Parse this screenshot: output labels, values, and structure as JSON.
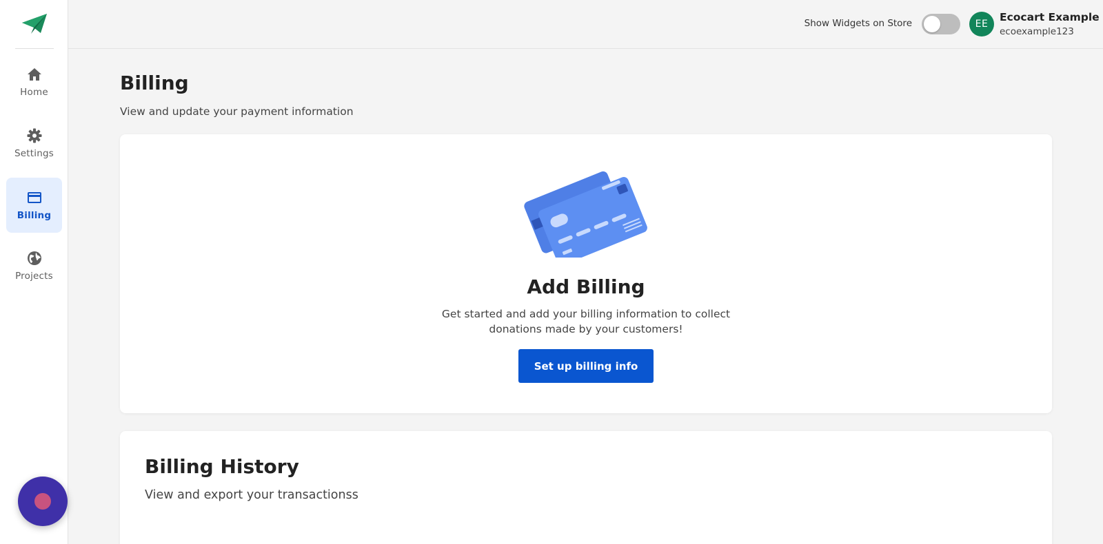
{
  "sidebar": {
    "logo_icon": "paper-plane-icon",
    "items": [
      {
        "label": "Home",
        "icon": "home-icon",
        "active": false
      },
      {
        "label": "Settings",
        "icon": "gear-icon",
        "active": false
      },
      {
        "label": "Billing",
        "icon": "credit-card-icon",
        "active": true
      },
      {
        "label": "Projects",
        "icon": "globe-icon",
        "active": false
      }
    ],
    "chat_icon": "chat-bubble-icon"
  },
  "topbar": {
    "toggle_label": "Show Widgets on Store",
    "toggle_on": false,
    "avatar_initials": "EE",
    "user_name": "Ecocart Example",
    "user_handle": "ecoexample123"
  },
  "page": {
    "title": "Billing",
    "subtitle": "View and update your payment information"
  },
  "add_billing": {
    "illustration": "credit-cards-illustration",
    "title": "Add Billing",
    "description": "Get started and add your billing information to collect donations made by your customers!",
    "button_label": "Set up billing info"
  },
  "billing_history": {
    "title": "Billing History",
    "subtitle": "View and export your transactionss"
  },
  "colors": {
    "brand_green": "#12855a",
    "primary_blue": "#0a56d0",
    "active_nav_bg": "#e4eefe",
    "active_nav_text": "#1355c7",
    "chat_bubble": "#3f30a8"
  }
}
